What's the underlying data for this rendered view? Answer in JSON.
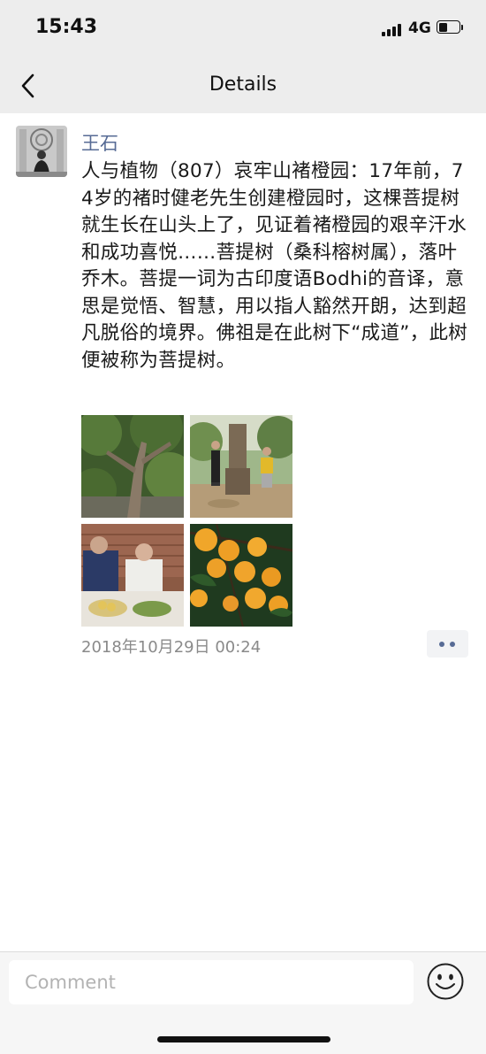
{
  "status_bar": {
    "time": "15:43",
    "network": "4G"
  },
  "nav": {
    "title": "Details",
    "back_icon": "chevron-left-icon"
  },
  "post": {
    "author": "王石",
    "text": "人与植物（807）哀牢山褚橙园：17年前，74岁的褚时健老先生创建橙园时，这棵菩提树就生长在山头上了，见证着褚橙园的艰辛汗水和成功喜悦……菩提树（桑科榕树属），落叶乔木。菩提一词为古印度语Bodhi的音译，意思是觉悟、智慧，用以指人豁然开朗，达到超凡脱俗的境界。佛祖是在此树下“成道”，此树便被称为菩提树。",
    "timestamp": "2018年10月29日 00:24",
    "photo_count": 4,
    "more_icon": "more-dots-icon"
  },
  "comment_bar": {
    "placeholder": "Comment",
    "emoji_icon": "smiley-icon"
  },
  "colors": {
    "link_blue": "#576b95",
    "bar_gray": "#ededed",
    "timestamp_gray": "#8a8a8a"
  }
}
